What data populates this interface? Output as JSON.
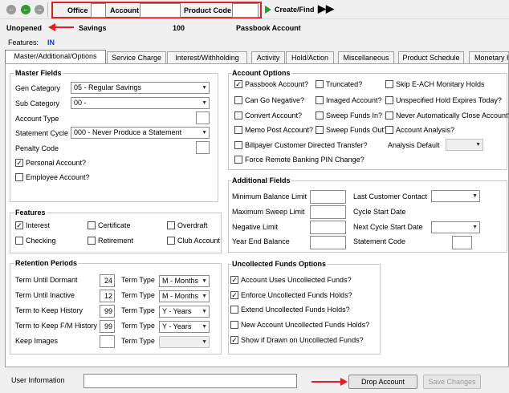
{
  "toolbar": {
    "office_label": "Office",
    "account_label": "Account",
    "product_code_label": "Product Code",
    "create_find_label": "Create/Find"
  },
  "header": {
    "status": "Unopened",
    "account_type": "Savings",
    "product_code": "100",
    "product_name": "Passbook Account",
    "features_label": "Features:",
    "features_value": "IN"
  },
  "tabs": [
    "Master/Additional/Options",
    "Service Charge",
    "Interest/Withholding",
    "Activity",
    "Hold/Action",
    "Miscellaneous",
    "Product Schedule",
    "Monetary H"
  ],
  "master_fields": {
    "title": "Master Fields",
    "gen_category_label": "Gen Category",
    "gen_category_value": "05 - Regular Savings",
    "sub_category_label": "Sub Category",
    "sub_category_value": "00 -",
    "account_type_label": "Account Type",
    "statement_cycle_label": "Statement Cycle",
    "statement_cycle_value": "000 - Never Produce a Statement",
    "penalty_code_label": "Penalty Code",
    "personal_account_label": "Personal Account?",
    "employee_account_label": "Employee Account?"
  },
  "features": {
    "title": "Features",
    "interest": "Interest",
    "certificate": "Certificate",
    "overdraft": "Overdraft",
    "checking": "Checking",
    "retirement": "Retirement",
    "club_account": "Club Account"
  },
  "retention": {
    "title": "Retention Periods",
    "rows": [
      {
        "label": "Term Until Dormant",
        "value": "24",
        "type_label": "Term Type",
        "type_value": "M - Months"
      },
      {
        "label": "Term Until Inactive",
        "value": "12",
        "type_label": "Term Type",
        "type_value": "M - Months"
      },
      {
        "label": "Term to Keep History",
        "value": "99",
        "type_label": "Term Type",
        "type_value": "Y - Years"
      },
      {
        "label": "Term to Keep F/M History",
        "value": "99",
        "type_label": "Term Type",
        "type_value": "Y - Years"
      },
      {
        "label": "Keep Images",
        "value": "",
        "type_label": "Term Type",
        "type_value": ""
      }
    ]
  },
  "account_options": {
    "title": "Account Options",
    "passbook": "Passbook Account?",
    "truncated": "Truncated?",
    "skip_ach": "Skip E-ACH Monitary Holds",
    "can_go_negative": "Can Go Negative?",
    "imaged": "Imaged Account?",
    "unspecified_hold": "Unspecified Hold Expires Today?",
    "convert": "Convert Account?",
    "sweep_in": "Sweep Funds In?",
    "never_close": "Never Automatically Close Account?",
    "memo_post": "Memo Post Account?",
    "sweep_out": "Sweep Funds Out?",
    "account_analysis": "Account Analysis?",
    "billpayer": "Billpayer Customer Directed Transfer?",
    "analysis_default": "Analysis Default",
    "force_pin": "Force Remote Banking PIN Change?"
  },
  "additional_fields": {
    "title": "Additional Fields",
    "min_balance": "Minimum Balance Limit",
    "last_contact": "Last Customer Contact",
    "max_sweep": "Maximum Sweep Limit",
    "cycle_start": "Cycle Start Date",
    "negative_limit": "Negative Limit",
    "next_cycle": "Next Cycle Start Date",
    "year_end": "Year End Balance",
    "statement_code": "Statement Code"
  },
  "uncollected": {
    "title": "Uncollected Funds Options",
    "uses": "Account Uses Uncollected Funds?",
    "enforce": "Enforce Uncollected Funds Holds?",
    "extend": "Extend Uncollected Funds Holds?",
    "new_account": "New Account Uncollected Funds Holds?",
    "show_drawn": "Show if Drawn on Uncollected Funds?"
  },
  "footer": {
    "user_info_label": "User Information",
    "drop_account": "Drop Account",
    "save_changes": "Save Changes"
  }
}
